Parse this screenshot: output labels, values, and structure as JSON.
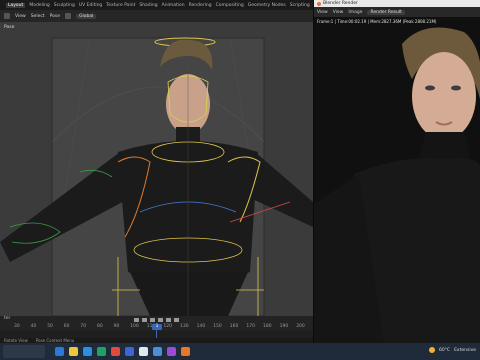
{
  "workspace_tabs": [
    "Layout",
    "Modeling",
    "Sculpting",
    "UV Editing",
    "Texture Paint",
    "Shading",
    "Animation",
    "Rendering",
    "Compositing",
    "Geometry Nodes",
    "Scripting"
  ],
  "viewport": {
    "mode_label": "Pose",
    "header_items": [
      "View",
      "Select",
      "Pose"
    ],
    "transform_dropdown": "Global"
  },
  "timeline": {
    "start_label": "ter",
    "ticks": [
      "30",
      "40",
      "50",
      "60",
      "70",
      "80",
      "90",
      "100",
      "110",
      "120",
      "130",
      "140",
      "150",
      "160",
      "170",
      "180",
      "190",
      "200"
    ],
    "current_frame": "1"
  },
  "statusbar": {
    "items": [
      "Rotate View",
      "Pose Context Menu"
    ]
  },
  "render_window": {
    "title": "Blender Render",
    "menu": [
      "View",
      "View",
      "Image"
    ],
    "slot_dropdown": "Render Result",
    "info": "Frame:1 | Time:00:02.19 | Mem:2827.36M (Peak 2808.21M)"
  },
  "taskbar": {
    "temperature": "60°C",
    "weather_label": "Extensive",
    "icon_colors": [
      "#2b79d8",
      "#f0c43c",
      "#2a8fe0",
      "#1ea462",
      "#e24a3c",
      "#3a66d6",
      "#dfe7ef",
      "#4b8fd6",
      "#9b4ad9",
      "#e8762b"
    ]
  }
}
